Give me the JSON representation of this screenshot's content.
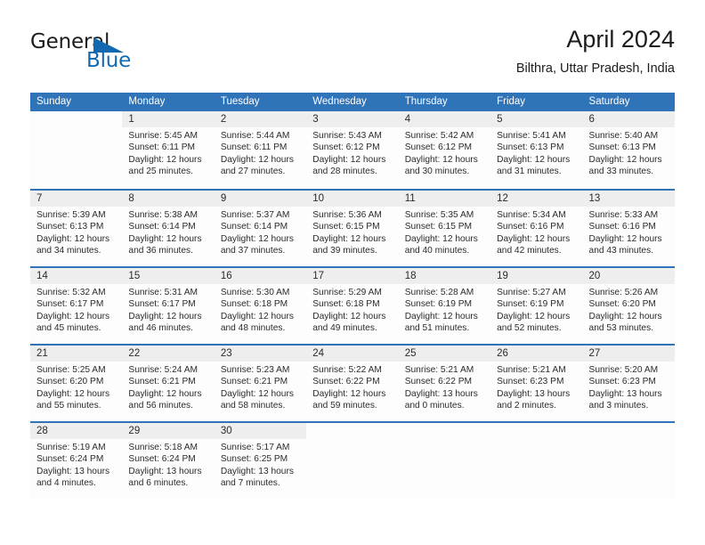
{
  "brand": {
    "name_part1": "General",
    "name_part2": "Blue",
    "accent_color": "#1269b0"
  },
  "header": {
    "month_title": "April 2024",
    "location": "Bilthra, Uttar Pradesh, India"
  },
  "theme": {
    "header_row_color": "#2f73b8",
    "day_band_color": "#eeeeee",
    "text_color": "#2b2b2b"
  },
  "weekday_headers": [
    "Sunday",
    "Monday",
    "Tuesday",
    "Wednesday",
    "Thursday",
    "Friday",
    "Saturday"
  ],
  "labels": {
    "sunrise_prefix": "Sunrise:",
    "sunset_prefix": "Sunset:",
    "daylight_prefix": "Daylight:"
  },
  "weeks": [
    [
      {
        "empty": true
      },
      {
        "day": "1",
        "sunrise": "Sunrise: 5:45 AM",
        "sunset": "Sunset: 6:11 PM",
        "daylight_line1": "Daylight: 12 hours",
        "daylight_line2": "and 25 minutes."
      },
      {
        "day": "2",
        "sunrise": "Sunrise: 5:44 AM",
        "sunset": "Sunset: 6:11 PM",
        "daylight_line1": "Daylight: 12 hours",
        "daylight_line2": "and 27 minutes."
      },
      {
        "day": "3",
        "sunrise": "Sunrise: 5:43 AM",
        "sunset": "Sunset: 6:12 PM",
        "daylight_line1": "Daylight: 12 hours",
        "daylight_line2": "and 28 minutes."
      },
      {
        "day": "4",
        "sunrise": "Sunrise: 5:42 AM",
        "sunset": "Sunset: 6:12 PM",
        "daylight_line1": "Daylight: 12 hours",
        "daylight_line2": "and 30 minutes."
      },
      {
        "day": "5",
        "sunrise": "Sunrise: 5:41 AM",
        "sunset": "Sunset: 6:13 PM",
        "daylight_line1": "Daylight: 12 hours",
        "daylight_line2": "and 31 minutes."
      },
      {
        "day": "6",
        "sunrise": "Sunrise: 5:40 AM",
        "sunset": "Sunset: 6:13 PM",
        "daylight_line1": "Daylight: 12 hours",
        "daylight_line2": "and 33 minutes."
      }
    ],
    [
      {
        "day": "7",
        "sunrise": "Sunrise: 5:39 AM",
        "sunset": "Sunset: 6:13 PM",
        "daylight_line1": "Daylight: 12 hours",
        "daylight_line2": "and 34 minutes."
      },
      {
        "day": "8",
        "sunrise": "Sunrise: 5:38 AM",
        "sunset": "Sunset: 6:14 PM",
        "daylight_line1": "Daylight: 12 hours",
        "daylight_line2": "and 36 minutes."
      },
      {
        "day": "9",
        "sunrise": "Sunrise: 5:37 AM",
        "sunset": "Sunset: 6:14 PM",
        "daylight_line1": "Daylight: 12 hours",
        "daylight_line2": "and 37 minutes."
      },
      {
        "day": "10",
        "sunrise": "Sunrise: 5:36 AM",
        "sunset": "Sunset: 6:15 PM",
        "daylight_line1": "Daylight: 12 hours",
        "daylight_line2": "and 39 minutes."
      },
      {
        "day": "11",
        "sunrise": "Sunrise: 5:35 AM",
        "sunset": "Sunset: 6:15 PM",
        "daylight_line1": "Daylight: 12 hours",
        "daylight_line2": "and 40 minutes."
      },
      {
        "day": "12",
        "sunrise": "Sunrise: 5:34 AM",
        "sunset": "Sunset: 6:16 PM",
        "daylight_line1": "Daylight: 12 hours",
        "daylight_line2": "and 42 minutes."
      },
      {
        "day": "13",
        "sunrise": "Sunrise: 5:33 AM",
        "sunset": "Sunset: 6:16 PM",
        "daylight_line1": "Daylight: 12 hours",
        "daylight_line2": "and 43 minutes."
      }
    ],
    [
      {
        "day": "14",
        "sunrise": "Sunrise: 5:32 AM",
        "sunset": "Sunset: 6:17 PM",
        "daylight_line1": "Daylight: 12 hours",
        "daylight_line2": "and 45 minutes."
      },
      {
        "day": "15",
        "sunrise": "Sunrise: 5:31 AM",
        "sunset": "Sunset: 6:17 PM",
        "daylight_line1": "Daylight: 12 hours",
        "daylight_line2": "and 46 minutes."
      },
      {
        "day": "16",
        "sunrise": "Sunrise: 5:30 AM",
        "sunset": "Sunset: 6:18 PM",
        "daylight_line1": "Daylight: 12 hours",
        "daylight_line2": "and 48 minutes."
      },
      {
        "day": "17",
        "sunrise": "Sunrise: 5:29 AM",
        "sunset": "Sunset: 6:18 PM",
        "daylight_line1": "Daylight: 12 hours",
        "daylight_line2": "and 49 minutes."
      },
      {
        "day": "18",
        "sunrise": "Sunrise: 5:28 AM",
        "sunset": "Sunset: 6:19 PM",
        "daylight_line1": "Daylight: 12 hours",
        "daylight_line2": "and 51 minutes."
      },
      {
        "day": "19",
        "sunrise": "Sunrise: 5:27 AM",
        "sunset": "Sunset: 6:19 PM",
        "daylight_line1": "Daylight: 12 hours",
        "daylight_line2": "and 52 minutes."
      },
      {
        "day": "20",
        "sunrise": "Sunrise: 5:26 AM",
        "sunset": "Sunset: 6:20 PM",
        "daylight_line1": "Daylight: 12 hours",
        "daylight_line2": "and 53 minutes."
      }
    ],
    [
      {
        "day": "21",
        "sunrise": "Sunrise: 5:25 AM",
        "sunset": "Sunset: 6:20 PM",
        "daylight_line1": "Daylight: 12 hours",
        "daylight_line2": "and 55 minutes."
      },
      {
        "day": "22",
        "sunrise": "Sunrise: 5:24 AM",
        "sunset": "Sunset: 6:21 PM",
        "daylight_line1": "Daylight: 12 hours",
        "daylight_line2": "and 56 minutes."
      },
      {
        "day": "23",
        "sunrise": "Sunrise: 5:23 AM",
        "sunset": "Sunset: 6:21 PM",
        "daylight_line1": "Daylight: 12 hours",
        "daylight_line2": "and 58 minutes."
      },
      {
        "day": "24",
        "sunrise": "Sunrise: 5:22 AM",
        "sunset": "Sunset: 6:22 PM",
        "daylight_line1": "Daylight: 12 hours",
        "daylight_line2": "and 59 minutes."
      },
      {
        "day": "25",
        "sunrise": "Sunrise: 5:21 AM",
        "sunset": "Sunset: 6:22 PM",
        "daylight_line1": "Daylight: 13 hours",
        "daylight_line2": "and 0 minutes."
      },
      {
        "day": "26",
        "sunrise": "Sunrise: 5:21 AM",
        "sunset": "Sunset: 6:23 PM",
        "daylight_line1": "Daylight: 13 hours",
        "daylight_line2": "and 2 minutes."
      },
      {
        "day": "27",
        "sunrise": "Sunrise: 5:20 AM",
        "sunset": "Sunset: 6:23 PM",
        "daylight_line1": "Daylight: 13 hours",
        "daylight_line2": "and 3 minutes."
      }
    ],
    [
      {
        "day": "28",
        "sunrise": "Sunrise: 5:19 AM",
        "sunset": "Sunset: 6:24 PM",
        "daylight_line1": "Daylight: 13 hours",
        "daylight_line2": "and 4 minutes."
      },
      {
        "day": "29",
        "sunrise": "Sunrise: 5:18 AM",
        "sunset": "Sunset: 6:24 PM",
        "daylight_line1": "Daylight: 13 hours",
        "daylight_line2": "and 6 minutes."
      },
      {
        "day": "30",
        "sunrise": "Sunrise: 5:17 AM",
        "sunset": "Sunset: 6:25 PM",
        "daylight_line1": "Daylight: 13 hours",
        "daylight_line2": "and 7 minutes."
      },
      {
        "empty": true
      },
      {
        "empty": true
      },
      {
        "empty": true
      },
      {
        "empty": true
      }
    ]
  ]
}
